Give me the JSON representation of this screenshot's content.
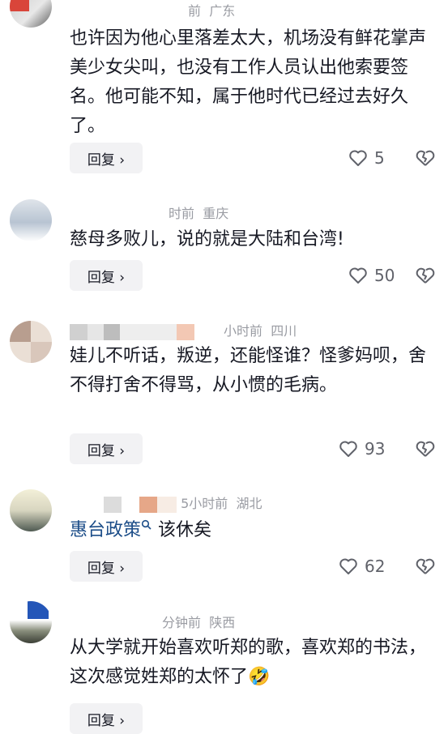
{
  "comments": [
    {
      "meta_time": "前",
      "meta_location": "广东",
      "text": "也许因为他心里落差太大，机场没有鲜花掌声美少女尖叫，也没有工作人员认出他索要签名。他可能不知，属于他时代已经过去好久了。",
      "reply_label": "回复 ›",
      "likes": "5"
    },
    {
      "meta_time": "时前",
      "meta_location": "重庆",
      "text": "慈母多败儿，说的就是大陆和台湾!",
      "reply_label": "回复 ›",
      "likes": "50"
    },
    {
      "meta_time": "小时前",
      "meta_location": "四川",
      "text": "娃儿不听话，叛逆，还能怪谁？怪爹妈呗，舍不得打舍不得骂，从小惯的毛病。",
      "reply_label": "回复 ›",
      "likes": "93"
    },
    {
      "meta_time": "5小时前",
      "meta_location": "湖北",
      "mention": "惠台政策",
      "text": "该休矣",
      "reply_label": "回复 ›",
      "likes": "62"
    },
    {
      "meta_time": "分钟前",
      "meta_location": "陕西",
      "text": "从大学就开始喜欢听郑的歌，喜欢郑的书法，这次感觉姓郑的太怀了",
      "emoji": "🤣",
      "reply_label": "回复 ›"
    }
  ],
  "colors": {
    "meta": "#9a9ca3",
    "text": "#161823",
    "mention": "#1d4e89",
    "reply_bg": "#f2f2f4"
  },
  "icons": [
    "heart-icon",
    "broken-heart-icon",
    "search-icon"
  ]
}
